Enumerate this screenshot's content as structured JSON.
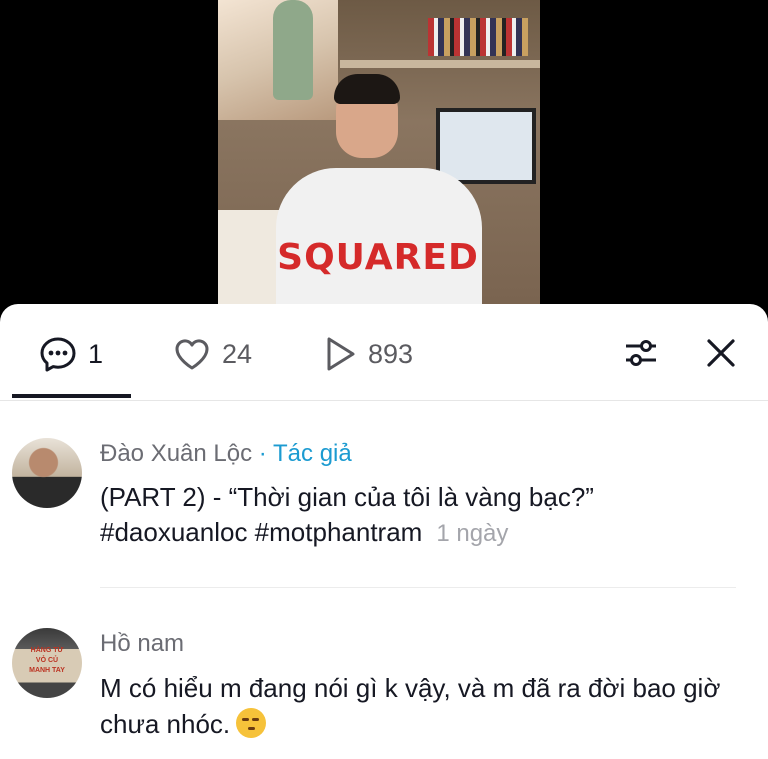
{
  "tabs": {
    "comments": {
      "icon": "comment-bubble-icon",
      "count": "1"
    },
    "likes": {
      "icon": "heart-icon",
      "count": "24"
    },
    "views": {
      "icon": "play-icon",
      "count": "893"
    }
  },
  "actions": {
    "filter_icon": "filter-sliders-icon",
    "close_icon": "close-icon"
  },
  "video": {
    "shirt_text": "SQUARED"
  },
  "comments": [
    {
      "name": "Đào Xuân Lộc",
      "separator": " · ",
      "tag": "Tác giả",
      "text": "(PART 2) - “Thời gian của tôi là vàng bạc?” #daoxuanloc #motphantram",
      "time": "1 ngày"
    },
    {
      "name": "Hồ nam",
      "text": "M có hiểu m đang nói gì k vậy, và m đã ra đời bao giờ chưa nhóc.",
      "emoji": "smirk-emoji"
    }
  ],
  "avatar_sign_text": "HÀNG TỪ VỎ\nCỦ MANH TAY",
  "colors": {
    "accent": "#1c9bd1",
    "text": "#161823",
    "muted": "#6b6c73",
    "time": "#a4a5ab"
  }
}
